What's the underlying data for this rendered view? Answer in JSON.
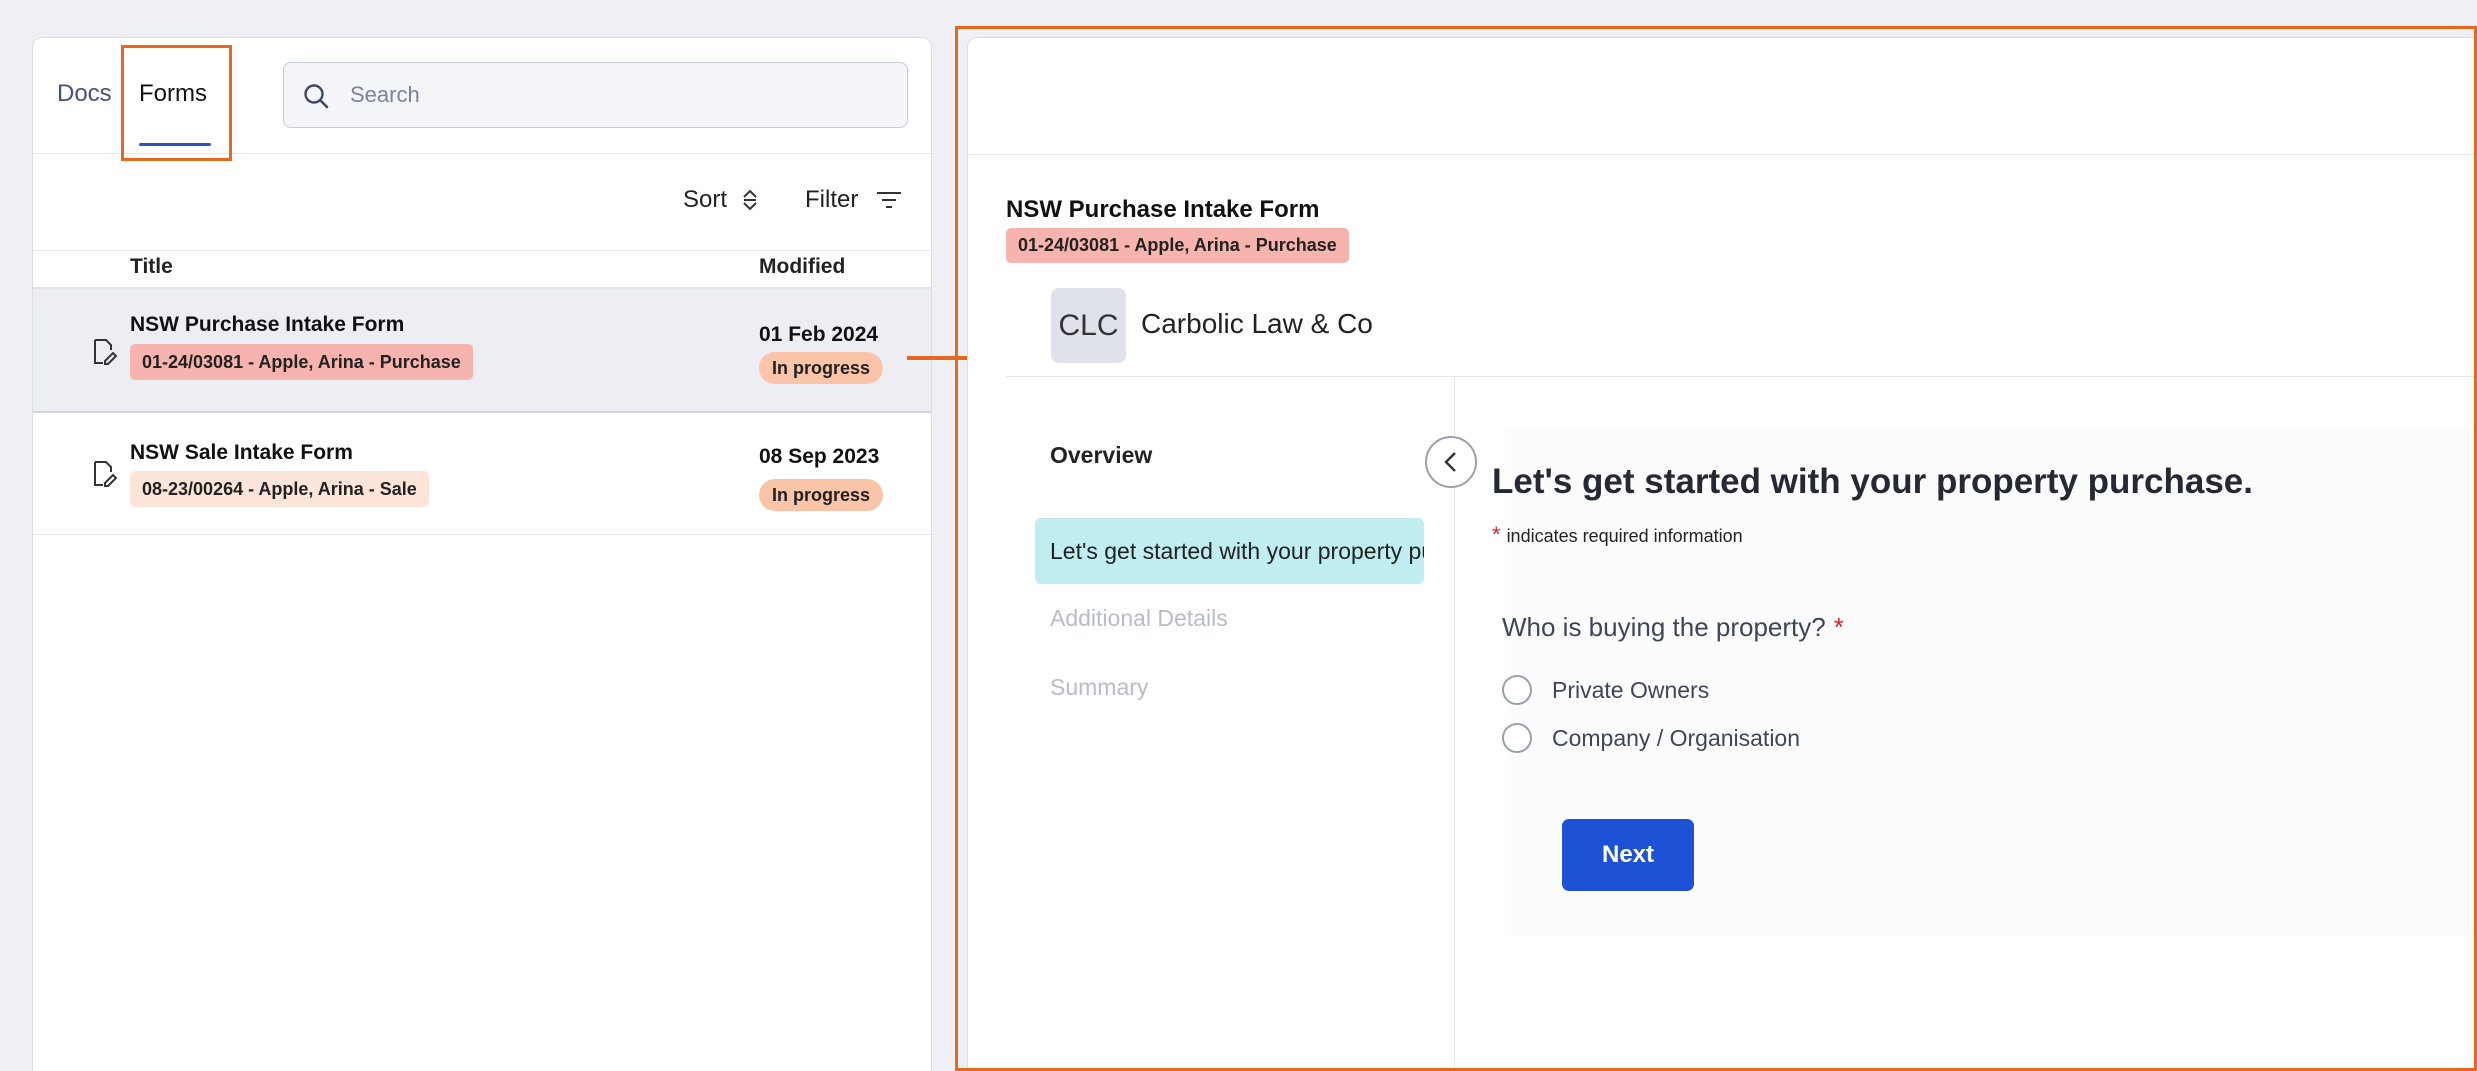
{
  "tabs": {
    "docs": "Docs",
    "forms": "Forms"
  },
  "search": {
    "placeholder": "Search"
  },
  "toolbar": {
    "sort_label": "Sort",
    "filter_label": "Filter"
  },
  "table": {
    "columns": [
      "Title",
      "Modified"
    ],
    "rows": [
      {
        "title": "NSW Purchase Intake Form",
        "tag": "01-24/03081 - Apple, Arina - Purchase",
        "modified": "01 Feb 2024",
        "status": "In progress"
      },
      {
        "title": "NSW Sale Intake Form",
        "tag": "08-23/00264 - Apple, Arina - Sale",
        "modified": "08 Sep 2023",
        "status": "In progress"
      }
    ]
  },
  "form": {
    "title": "NSW Purchase Intake Form",
    "tag": "01-24/03081 - Apple, Arina - Purchase",
    "firm_initials": "CLC",
    "firm_name": "Carbolic Law & Co",
    "overview_label": "Overview",
    "steps": [
      "Let's get started with your property purchase.",
      "Additional Details",
      "Summary"
    ],
    "heading": "Let's get started with your property purchase.",
    "required_note": "indicates required information",
    "question": "Who is buying the property?",
    "options": [
      "Private Owners",
      "Company / Organisation"
    ],
    "next_label": "Next"
  },
  "colors": {
    "accent": "#1e52d6",
    "highlight": "#e8671e",
    "tag_purchase": "#f7b3ad",
    "tag_sale": "#fde5da",
    "status_badge": "#f9c4a7",
    "active_step": "#bfedf0"
  },
  "icons": [
    "search-icon",
    "sort-icon",
    "filter-icon",
    "form-edit-icon",
    "chevron-left-icon"
  ]
}
